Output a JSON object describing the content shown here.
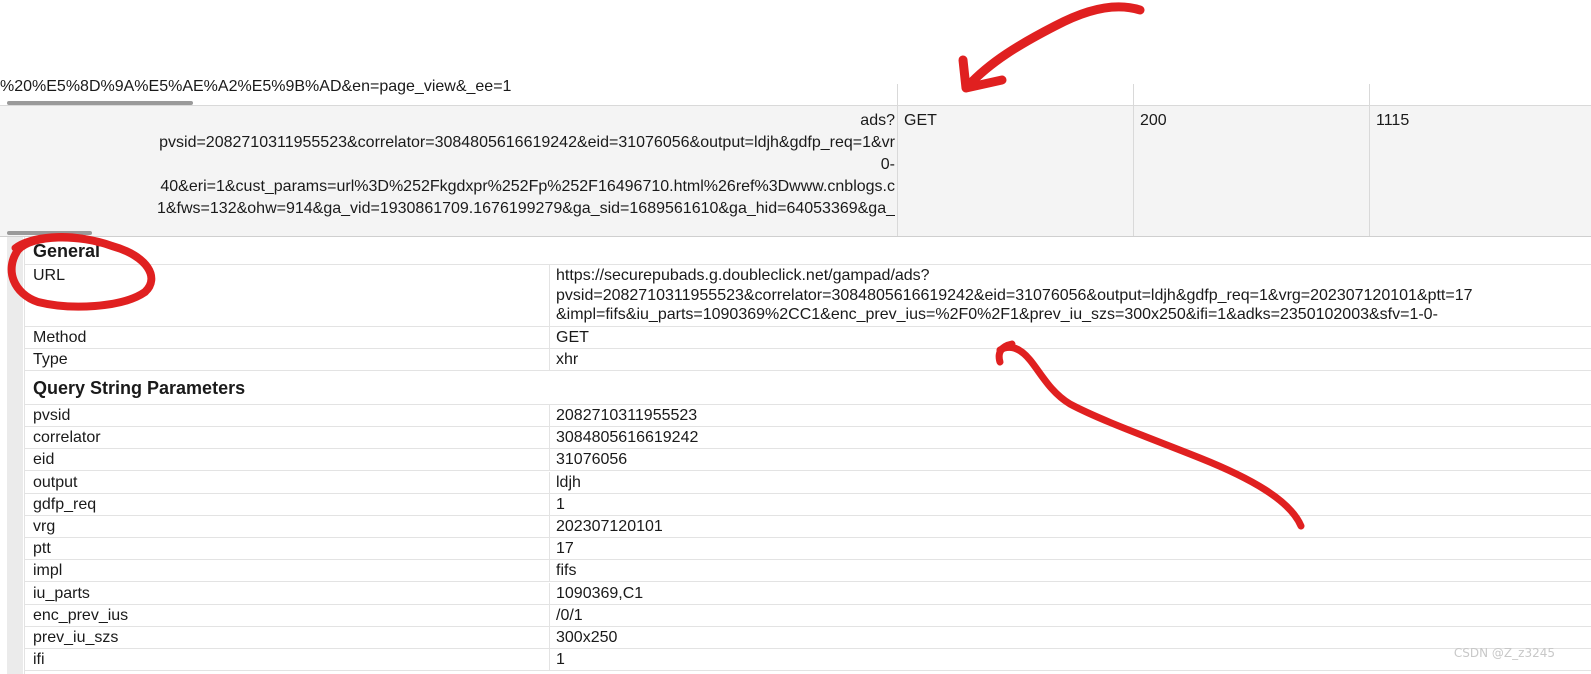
{
  "request_list": {
    "previous_row_url_tail": "%20%E5%8D%9A%E5%AE%A2%E5%9B%AD&en=page_view&_ee=1",
    "selected_row": {
      "url_lines": [
        "ads?",
        "pvsid=2082710311955523&correlator=3084805616619242&eid=31076056&output=ldjh&gdfp_req=1&vr",
        "0-",
        "40&eri=1&cust_params=url%3D%252Fkgdxpr%252Fp%252F16496710.html%26ref%3Dwww.cnblogs.c",
        "1&fws=132&ohw=914&ga_vid=1930861709.1676199279&ga_sid=1689561610&ga_hid=64053369&ga_"
      ],
      "method": "GET",
      "status": "200",
      "size": "1115"
    }
  },
  "details": {
    "general": {
      "title": "General",
      "url_label": "URL",
      "url_lines": [
        "https://securepubads.g.doubleclick.net/gampad/ads?",
        "pvsid=2082710311955523&correlator=3084805616619242&eid=31076056&output=ldjh&gdfp_req=1&vrg=202307120101&ptt=17",
        "&impl=fifs&iu_parts=1090369%2CC1&enc_prev_ius=%2F0%2F1&prev_iu_szs=300x250&ifi=1&adks=2350102003&sfv=1-0-"
      ],
      "method_label": "Method",
      "method_value": "GET",
      "type_label": "Type",
      "type_value": "xhr"
    },
    "query": {
      "title": "Query String Parameters",
      "params": [
        {
          "key": "pvsid",
          "value": "2082710311955523"
        },
        {
          "key": "correlator",
          "value": "3084805616619242"
        },
        {
          "key": "eid",
          "value": "31076056"
        },
        {
          "key": "output",
          "value": "ldjh"
        },
        {
          "key": "gdfp_req",
          "value": "1"
        },
        {
          "key": "vrg",
          "value": "202307120101"
        },
        {
          "key": "ptt",
          "value": "17"
        },
        {
          "key": "impl",
          "value": "fifs"
        },
        {
          "key": "iu_parts",
          "value": "1090369,C1"
        },
        {
          "key": "enc_prev_ius",
          "value": "/0/1"
        },
        {
          "key": "prev_iu_szs",
          "value": "300x250"
        },
        {
          "key": "ifi",
          "value": "1"
        }
      ]
    }
  },
  "watermark": "CSDN @Z_z3245",
  "colors": {
    "annotation": "#e02020",
    "selected_row_bg": "#f4f4f4",
    "grid_line": "#e3e3e3"
  }
}
